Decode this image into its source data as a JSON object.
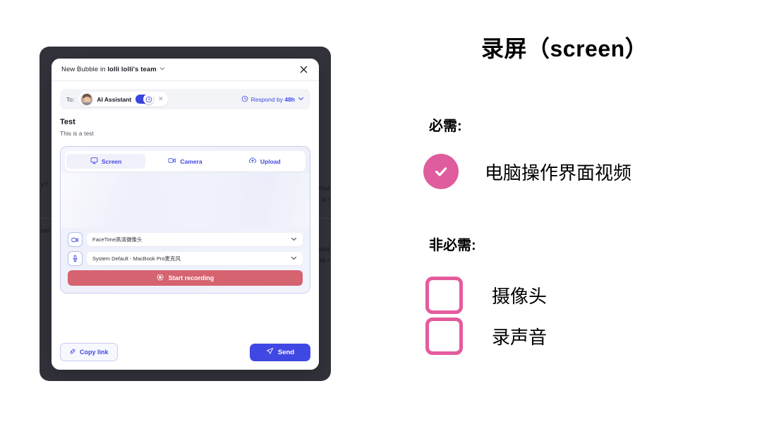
{
  "app": {
    "header": {
      "prefix": "New Bubble in ",
      "team": "lolli lolli's team",
      "caret_icon": "chevron-down-icon",
      "close_icon": "close-icon"
    },
    "recipients": {
      "to_label": "To:",
      "chip_name": "AI Assistant",
      "remove_icon": "close-icon",
      "toggle_state": "on",
      "toggle_knob_icon": "clock-icon",
      "respond_prefix": "Respond by ",
      "respond_value": "48h",
      "respond_icon": "clock-icon",
      "respond_caret_icon": "chevron-down-icon"
    },
    "message": {
      "title": "Test",
      "body": "This is a test"
    },
    "recorder": {
      "tabs": [
        {
          "label": "Screen",
          "icon": "monitor-icon",
          "active": true
        },
        {
          "label": "Camera",
          "icon": "video-camera-icon",
          "active": false
        },
        {
          "label": "Upload",
          "icon": "cloud-upload-icon",
          "active": false
        }
      ],
      "camera_select": {
        "icon": "video-camera-icon",
        "value": "FaceTime高清摄像头",
        "caret_icon": "chevron-down-icon"
      },
      "mic_select": {
        "icon": "microphone-icon",
        "value": "System Default - MacBook Pro麦克风",
        "caret_icon": "chevron-down-icon"
      },
      "record_button": {
        "label": "Start recording",
        "icon": "record-dot-icon",
        "color": "#d66370"
      }
    },
    "footer": {
      "copy_link_label": "Copy link",
      "copy_link_icon": "link-icon",
      "send_label": "Send",
      "send_icon": "send-plane-icon",
      "send_color": "#4048e3"
    },
    "background_fragments": [
      "y?",
      "nel",
      "You",
      "d •",
      "load",
      "ld •"
    ]
  },
  "notes": {
    "title": "录屏（screen）",
    "required_heading": "必需:",
    "optional_heading": "非必需:",
    "required_items": [
      {
        "label": "电脑操作界面视频",
        "state": "checked",
        "icon": "check-circle-icon"
      }
    ],
    "optional_items": [
      {
        "label": "摄像头",
        "state": "unchecked",
        "icon": "empty-checkbox-icon"
      },
      {
        "label": "录声音",
        "state": "unchecked",
        "icon": "empty-checkbox-icon"
      }
    ],
    "accent_color": "#df5c9e"
  }
}
